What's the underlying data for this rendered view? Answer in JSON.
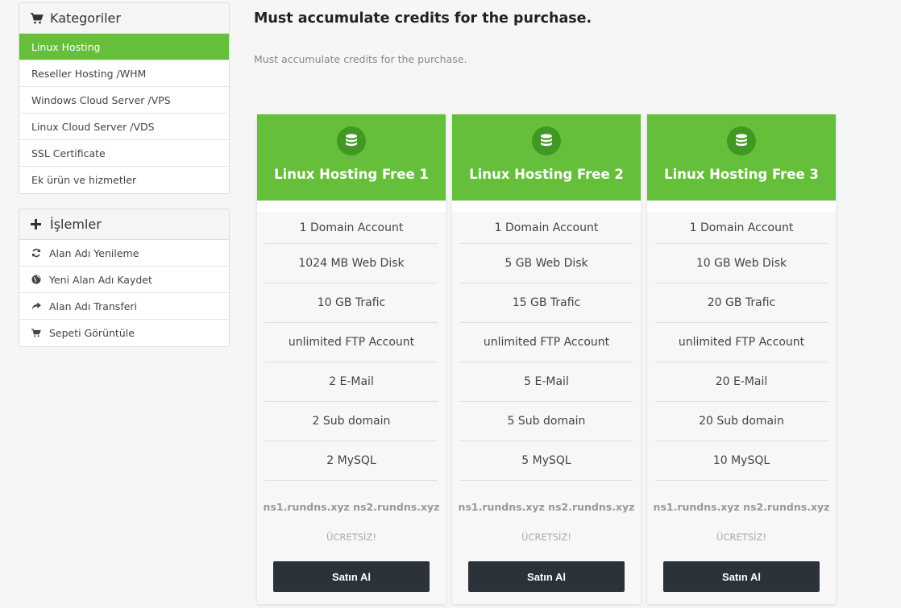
{
  "sidebar": {
    "categories": {
      "title": "Kategoriler",
      "icon": "cart-icon",
      "items": [
        {
          "label": "Linux Hosting",
          "active": true
        },
        {
          "label": "Reseller Hosting /WHM"
        },
        {
          "label": "Windows Cloud Server /VPS"
        },
        {
          "label": "Linux Cloud Server /VDS"
        },
        {
          "label": "SSL Certificate"
        },
        {
          "label": "Ek ürün ve hizmetler"
        }
      ]
    },
    "actions": {
      "title": "İşlemler",
      "icon": "plus-icon",
      "items": [
        {
          "label": "Alan Adı Yenileme",
          "icon": "refresh-icon"
        },
        {
          "label": "Yeni Alan Adı Kaydet",
          "icon": "globe-icon"
        },
        {
          "label": "Alan Adı Transferi",
          "icon": "share-arrow-icon"
        },
        {
          "label": "Sepeti Görüntüle",
          "icon": "cart-icon"
        }
      ]
    }
  },
  "main": {
    "title": "Must accumulate credits for the purchase.",
    "subtitle": "Must accumulate credits for the purchase.",
    "plans": [
      {
        "name": "Linux Hosting Free 1",
        "features": [
          "1 Domain Account",
          "1024 MB Web Disk",
          "10 GB Trafic",
          "unlimited FTP Account",
          "2 E-Mail",
          "2 Sub domain",
          "2 MySQL"
        ],
        "nameservers": "ns1.rundns.xyz ns2.rundns.xyz",
        "price": "ÜCRETSİZ!",
        "button": "Satın Al"
      },
      {
        "name": "Linux Hosting Free 2",
        "features": [
          "1 Domain Account",
          "5 GB Web Disk",
          "15 GB Trafic",
          "unlimited FTP Account",
          "5 E-Mail",
          "5 Sub domain",
          "5 MySQL"
        ],
        "nameservers": "ns1.rundns.xyz ns2.rundns.xyz",
        "price": "ÜCRETSİZ!",
        "button": "Satın Al"
      },
      {
        "name": "Linux Hosting Free 3",
        "features": [
          "1 Domain Account",
          "10 GB Web Disk",
          "20 GB Trafic",
          "unlimited FTP Account",
          "20 E-Mail",
          "20 Sub domain",
          "10 MySQL"
        ],
        "nameservers": "ns1.rundns.xyz ns2.rundns.xyz",
        "price": "ÜCRETSİZ!",
        "button": "Satın Al"
      }
    ]
  },
  "colors": {
    "accent": "#66bf3a",
    "accent_dark": "#3f9922",
    "button": "#2b323a"
  }
}
